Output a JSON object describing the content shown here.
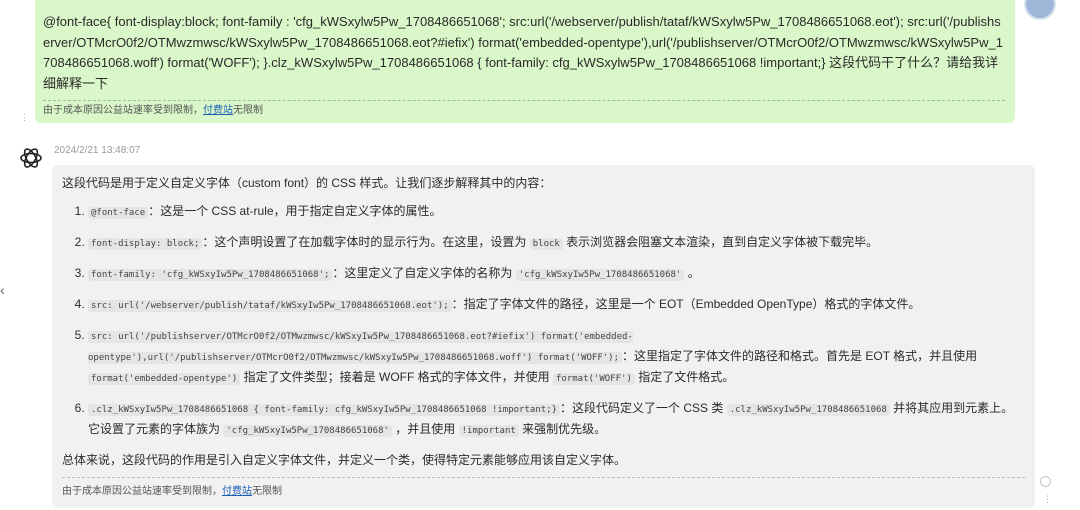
{
  "user_message": {
    "text": "@font-face{ font-display:block;    font-family : 'cfg_kWSxylw5Pw_1708486651068';        src:url('/webserver/publish/tataf/kWSxylw5Pw_1708486651068.eot'); src:url('/publishserver/OTMcrO0f2/OTMwzmwsc/kWSxylw5Pw_1708486651068.eot?#iefix') format('embedded-opentype'),url('/publishserver/OTMcrO0f2/OTMwzmwsc/kWSxylw5Pw_1708486651068.woff') format('WOFF');   }.clz_kWSxylw5Pw_1708486651068 {  font-family: cfg_kWSxylw5Pw_1708486651068 !important;}  这段代码干了什么？请给我详细解释一下",
    "notice_prefix": "由于成本原因公益站速率受到限制，",
    "notice_link": "付费站",
    "notice_suffix": "无限制",
    "menu_dots": "⋮"
  },
  "bot_message": {
    "timestamp": "2024/2/21 13:48:07",
    "intro": "这段代码是用于定义自定义字体（custom font）的 CSS 样式。让我们逐步解释其中的内容：",
    "items": [
      {
        "code1": "@font-face",
        "text1": "：这是一个 CSS at-rule，用于指定自定义字体的属性。"
      },
      {
        "code1": "font-display: block;",
        "text1": "：这个声明设置了在加载字体时的显示行为。在这里，设置为",
        "code2": "block",
        "text2": "表示浏览器会阻塞文本渲染，直到自定义字体被下载完毕。"
      },
      {
        "code1": "font-family: 'cfg_kWSxyIw5Pw_1708486651068';",
        "text1": "：这里定义了自定义字体的名称为",
        "code2": "'cfg_kWSxyIw5Pw_1708486651068'",
        "text2": "。"
      },
      {
        "code1": "src: url('/webserver/publish/tataf/kWSxyIw5Pw_1708486651068.eot');",
        "text1": "：指定了字体文件的路径，这里是一个 EOT（Embedded OpenType）格式的字体文件。"
      },
      {
        "code1": "src: url('/publishserver/OTMcrO0f2/OTMwzmwsc/kWSxyIw5Pw_1708486651068.eot?#iefix') format('embedded-opentype'),url('/publishserver/OTMcrO0f2/OTMwzmwsc/kWSxyIw5Pw_1708486651068.woff') format('WOFF');",
        "text1": "：这里指定了字体文件的路径和格式。首先是 EOT 格式，并且使用",
        "code2": "format('embedded-opentype')",
        "text2": "指定了文件类型；接着是 WOFF 格式的字体文件，并使用",
        "code3": "format('WOFF')",
        "text3": "指定了文件格式。"
      },
      {
        "code1": ".clz_kWSxyIw5Pw_1708486651068 {    font-family: cfg_kWSxyIw5Pw_1708486651068 !important;}",
        "text1": "：这段代码定义了一个 CSS 类",
        "code2": ".clz_kWSxyIw5Pw_1708486651068",
        "text2": "并将其应用到元素上。它设置了元素的字体族为",
        "code3": "'cfg_kWSxyIw5Pw_1708486651068'",
        "text3": "，并且使用",
        "code4": "!important",
        "text4": "来强制优先级。"
      }
    ],
    "summary": "总体来说，这段代码的作用是引入自定义字体文件，并定义一个类，使得特定元素能够应用该自定义字体。",
    "notice_prefix": "由于成本原因公益站速率受到限制，",
    "notice_link": "付费站",
    "notice_suffix": "无限制"
  },
  "nav": {
    "left_arrow": "‹",
    "scroll_dots": "⋮"
  }
}
